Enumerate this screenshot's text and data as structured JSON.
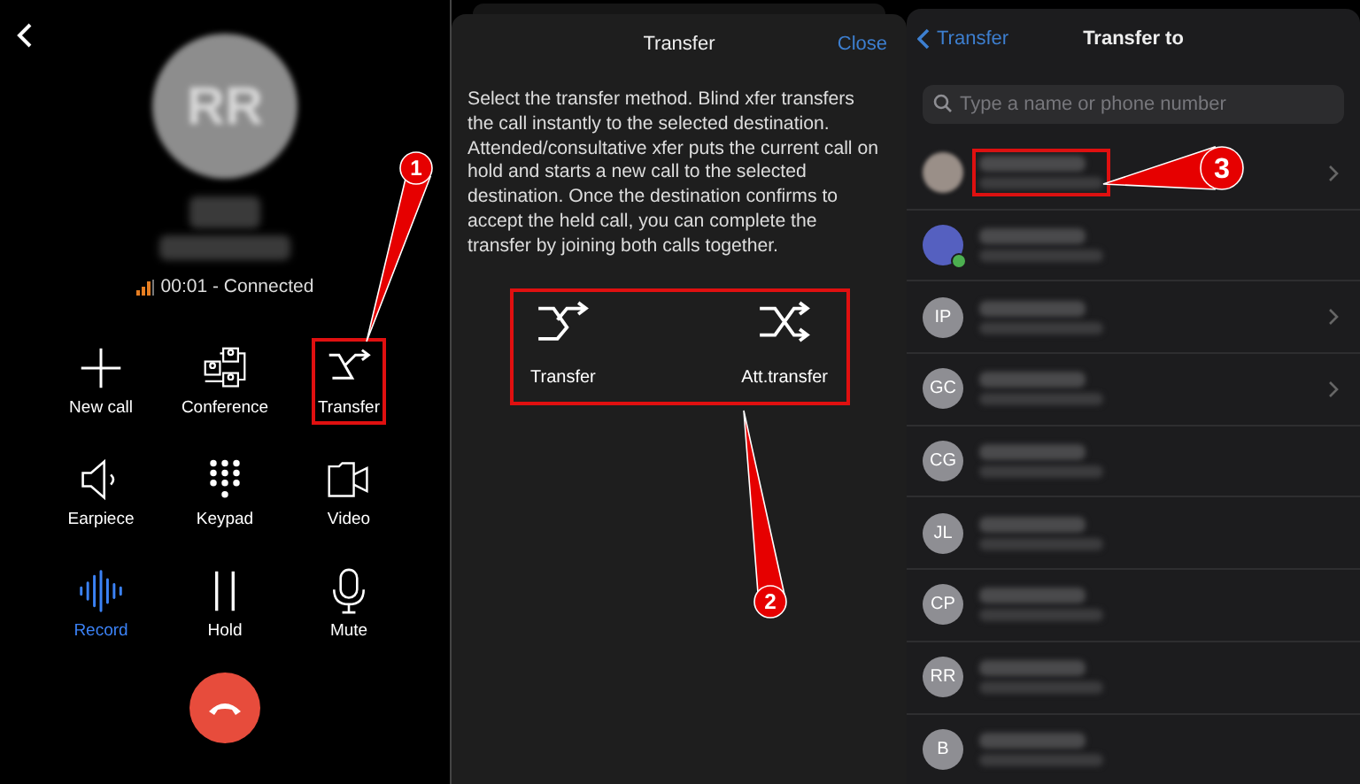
{
  "call_screen": {
    "avatar_initials": "RR",
    "status": "00:01 - Connected",
    "actions": [
      {
        "label": "New call",
        "kind": "plus",
        "active": false,
        "highlighted": false
      },
      {
        "label": "Conference",
        "kind": "conference",
        "active": false,
        "highlighted": false
      },
      {
        "label": "Transfer",
        "kind": "transfer",
        "active": false,
        "highlighted": true
      },
      {
        "label": "Earpiece",
        "kind": "speaker",
        "active": false,
        "highlighted": false
      },
      {
        "label": "Keypad",
        "kind": "keypad",
        "active": false,
        "highlighted": false
      },
      {
        "label": "Video",
        "kind": "video",
        "active": false,
        "highlighted": false
      },
      {
        "label": "Record",
        "kind": "waveform",
        "active": true,
        "highlighted": false
      },
      {
        "label": "Hold",
        "kind": "pause",
        "active": false,
        "highlighted": false
      },
      {
        "label": "Mute",
        "kind": "mic",
        "active": false,
        "highlighted": false
      }
    ]
  },
  "transfer_sheet": {
    "title": "Transfer",
    "close": "Close",
    "description": "Select the transfer method. Blind xfer transfers the call instantly to the selected destination. Attended/consultative xfer puts the current call on hold and starts a new call to the selected destination. Once the destination confirms to accept the held call, you can complete the transfer by joining both calls together.",
    "methods_highlighted": true,
    "methods": [
      {
        "label": "Transfer",
        "kind": "blind"
      },
      {
        "label": "Att.transfer",
        "kind": "attended"
      }
    ]
  },
  "transfer_to": {
    "back": "Transfer",
    "title": "Transfer to",
    "search": {
      "placeholder": "Type a name or phone number"
    },
    "contacts": [
      {
        "kind": "photo",
        "chevron": true,
        "highlighted": true
      },
      {
        "kind": "group",
        "online": true,
        "chevron": false,
        "highlighted": false
      },
      {
        "kind": "initials",
        "initials": "IP",
        "chevron": true,
        "highlighted": false
      },
      {
        "kind": "initials",
        "initials": "GC",
        "chevron": true,
        "highlighted": false
      },
      {
        "kind": "initials",
        "initials": "CG",
        "chevron": false,
        "highlighted": false
      },
      {
        "kind": "initials",
        "initials": "JL",
        "chevron": false,
        "highlighted": false
      },
      {
        "kind": "initials",
        "initials": "CP",
        "chevron": false,
        "highlighted": false
      },
      {
        "kind": "initials",
        "initials": "RR",
        "chevron": false,
        "highlighted": false
      },
      {
        "kind": "initials",
        "initials": "B",
        "chevron": false,
        "highlighted": false
      }
    ]
  },
  "annotations": [
    {
      "number": "1"
    },
    {
      "number": "2"
    },
    {
      "number": "3"
    }
  ]
}
